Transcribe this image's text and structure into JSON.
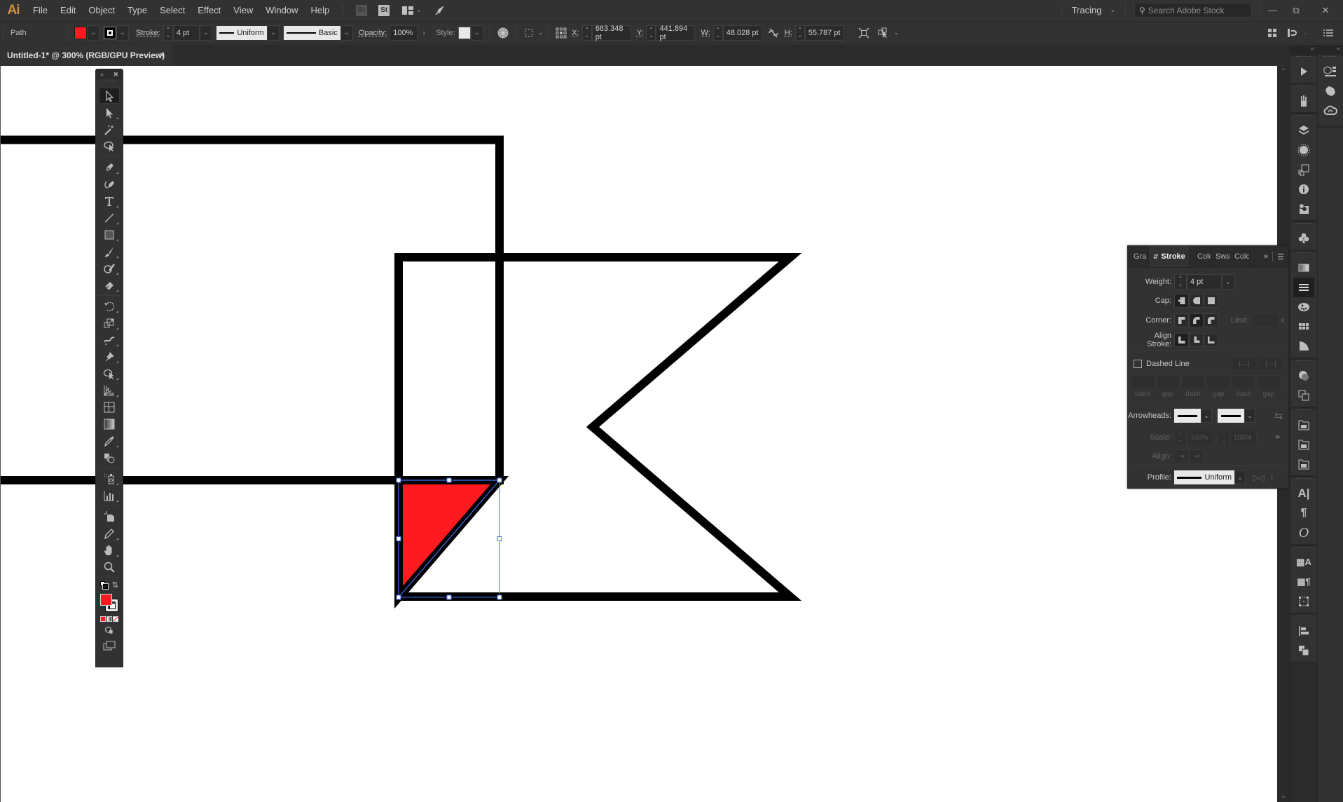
{
  "app": {
    "logo": "Ai",
    "menu": [
      "File",
      "Edit",
      "Object",
      "Type",
      "Select",
      "Effect",
      "View",
      "Window",
      "Help"
    ],
    "bridge_label": "Br",
    "stock_label": "St",
    "workspace": "Tracing",
    "search_placeholder": "Search Adobe Stock"
  },
  "controlbar": {
    "selection_type": "Path",
    "fill_color": "#ff1a1f",
    "stroke_label": "Stroke:",
    "stroke_weight": "4 pt",
    "variable_width_profile": "Uniform",
    "brush_definition": "Basic",
    "opacity_label": "Opacity:",
    "opacity": "100%",
    "style_label": "Style:",
    "x_label": "X:",
    "x": "663.348 pt",
    "y_label": "Y:",
    "y": "441.894 pt",
    "w_label": "W:",
    "w": "48.028 pt",
    "h_label": "H:",
    "h": "55.787 pt"
  },
  "document": {
    "tab_title": "Untitled-1* @ 300% (RGB/GPU Preview)",
    "close_glyph": "×"
  },
  "artwork": {
    "stroke_color": "#000000",
    "selection_color": "#4a6ef5",
    "selected_fill": "#ff1a1f"
  },
  "tools": {
    "items": [
      "selection",
      "direct-selection",
      "magic-wand",
      "lasso",
      "pen",
      "curvature",
      "type",
      "line-segment",
      "rectangle",
      "paintbrush",
      "shaper",
      "eraser",
      "rotate",
      "scale",
      "warp",
      "puppet-warp",
      "shape-builder",
      "perspective-grid",
      "mesh",
      "gradient",
      "eyedropper",
      "blend",
      "symbol-sprayer",
      "column-graph",
      "artboard",
      "slice",
      "hand",
      "zoom"
    ],
    "fill_color": "#ff1a1f"
  },
  "stroke_panel": {
    "tabs": [
      "Gra",
      "Stroke",
      "Colo",
      "Swa",
      "Colo"
    ],
    "active_tab": "Stroke",
    "weight_label": "Weight:",
    "weight": "4 pt",
    "cap_label": "Cap:",
    "corner_label": "Corner:",
    "limit_label": "Limit:",
    "limit_suffix": "x",
    "align_label": "Align Stroke:",
    "dashed_label": "Dashed Line",
    "dashed_checked": false,
    "dash_labels": [
      "dash",
      "gap",
      "dash",
      "gap",
      "dash",
      "gap"
    ],
    "arrowheads_label": "Arrowheads:",
    "scale_label": "Scale:",
    "scale_start": "100%",
    "scale_end": "100%",
    "align_arrow_label": "Align:",
    "profile_label": "Profile:",
    "profile": "Uniform"
  }
}
